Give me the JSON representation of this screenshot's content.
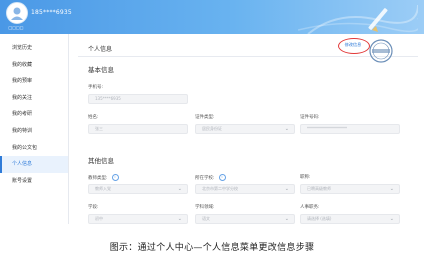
{
  "header": {
    "phone": "185****6935",
    "avatar_caption": "□□□□",
    "colors": {
      "accent": "#4a98e6",
      "highlight_ring": "#e23a3a"
    }
  },
  "sidebar": {
    "items": [
      {
        "label": "浏览历史"
      },
      {
        "label": "我的收藏"
      },
      {
        "label": "我的预审"
      },
      {
        "label": "我的关注"
      },
      {
        "label": "我的考研"
      },
      {
        "label": "我的特训"
      },
      {
        "label": "我的公文包"
      },
      {
        "label": "个人信息",
        "active": true
      },
      {
        "label": "账号设置"
      }
    ]
  },
  "main": {
    "tab_title": "个人信息",
    "edit_button": "修改信息",
    "basic_section": "基本信息",
    "other_section": "其他信息",
    "fields": {
      "phone_label": "手机号:",
      "phone_value": "135****6935",
      "name_label": "姓名:",
      "name_value": "张三",
      "idtype_label": "证件类型:",
      "idtype_value": "居民身份证",
      "idnum_label": "证件号码:",
      "idnum_value": "********************",
      "teacher_type_label": "教师类型:",
      "teacher_type_value": "教师入党",
      "school_label": "所在学校:",
      "school_value": "北京市第二中学分校",
      "title_label": "职称:",
      "title_value": "已聘高级教师",
      "stage_label": "学段:",
      "stage_value": "初中",
      "subject_label": "学科领域:",
      "subject_value": "语文",
      "position_label": "人事职务:",
      "position_value": "请选择 (选填)"
    }
  },
  "caption": "图示：通过个人中心—个人信息菜单更改信息步骤"
}
